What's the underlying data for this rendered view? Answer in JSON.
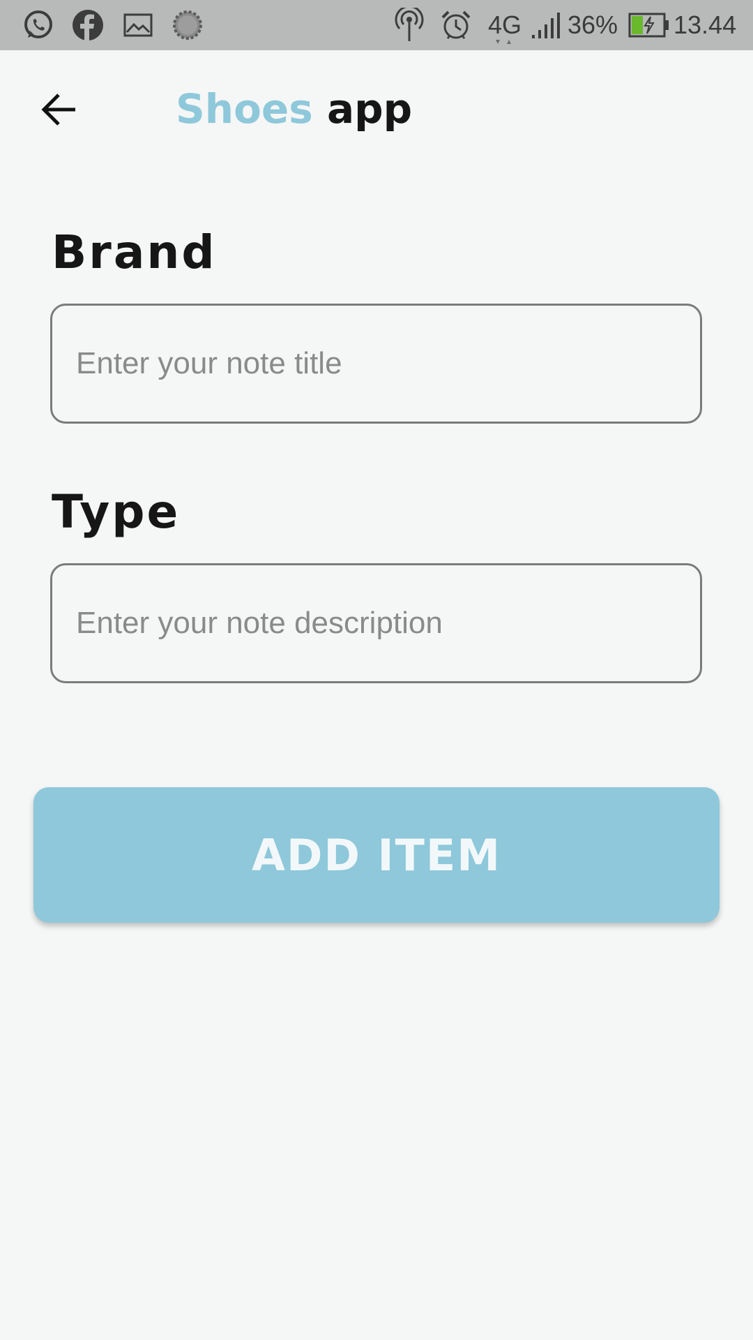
{
  "status_bar": {
    "left_icons": [
      "whatsapp-icon",
      "facebook-icon",
      "gallery-icon",
      "loading-icon"
    ],
    "right_icons": [
      "hotspot-icon",
      "alarm-icon",
      "signal-icon",
      "battery-charging-icon"
    ],
    "network": "4G",
    "battery": "36%",
    "time": "13.44",
    "battery_fill_color": "#6ab82c"
  },
  "app_bar": {
    "back_icon": "arrow-left-icon",
    "title_brand": "Shoes",
    "title_suffix": "app",
    "brand_color": "#8ec8da"
  },
  "form": {
    "brand_label": "Brand",
    "brand_placeholder": "Enter your note title",
    "type_label": "Type",
    "type_placeholder": "Enter your note description"
  },
  "actions": {
    "add_label": "ADD ITEM",
    "button_color": "#8ec8da"
  }
}
